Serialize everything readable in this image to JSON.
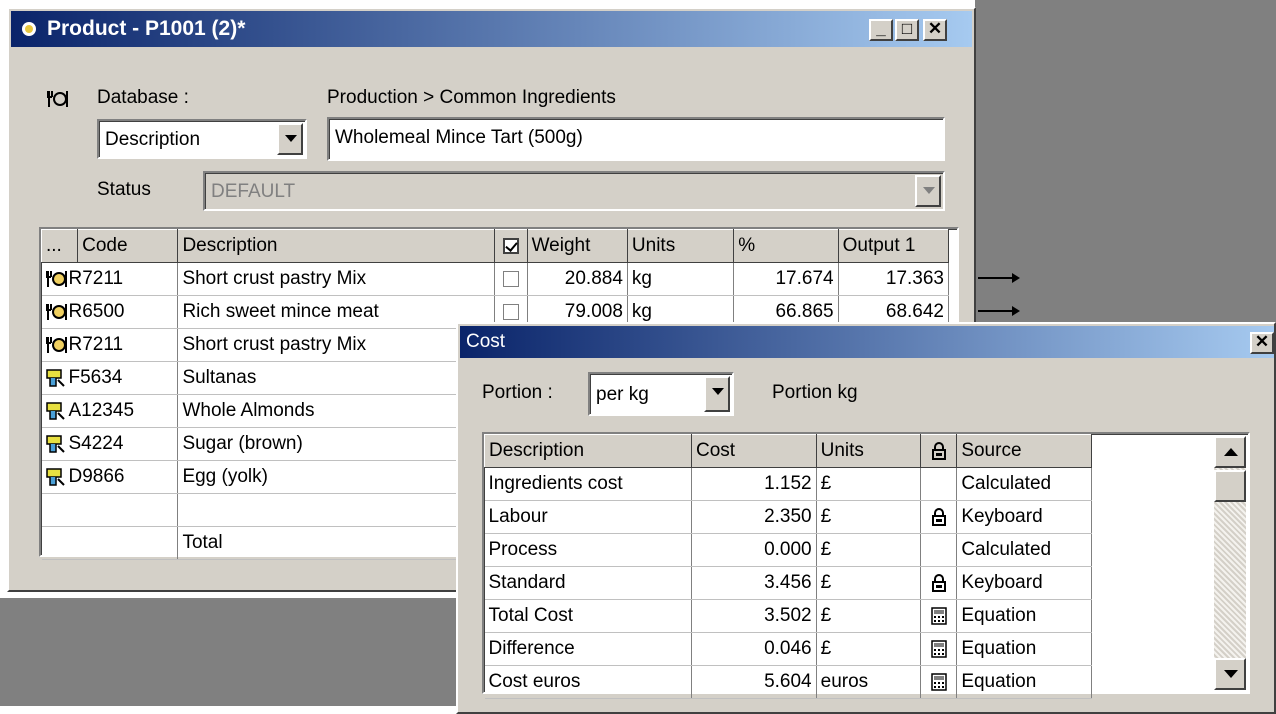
{
  "product_window": {
    "title": "Product - P1001 (2)*",
    "minimize": "_",
    "maximize": "□",
    "close": "✕",
    "database_label": "Database :",
    "breadcrumb": "Production > Common Ingredients",
    "field_select": "Description",
    "description_value": "Wholemeal Mince Tart (500g)",
    "status_label": "Status",
    "status_value": "DEFAULT"
  },
  "ingredients_grid": {
    "columns": [
      "...",
      "Code",
      "Description",
      "",
      "Weight",
      "Units",
      "%",
      "Output 1"
    ],
    "rows": [
      {
        "icon": "pot-icon",
        "code": "R7211",
        "description": "Short crust pastry Mix",
        "weight": "20.884",
        "units": "kg",
        "percent": "17.674",
        "output": "17.363"
      },
      {
        "icon": "pot-icon",
        "code": "R6500",
        "description": "Rich sweet mince meat",
        "weight": "79.008",
        "units": "kg",
        "percent": "66.865",
        "output": "68.642"
      },
      {
        "icon": "pot-icon",
        "code": "R7211",
        "description": "Short crust pastry Mix",
        "weight": "",
        "units": "",
        "percent": "",
        "output": ""
      },
      {
        "icon": "hand-icon",
        "code": "F5634",
        "description": "Sultanas",
        "weight": "",
        "units": "",
        "percent": "",
        "output": ""
      },
      {
        "icon": "hand-icon",
        "code": "A12345",
        "description": "Whole Almonds",
        "weight": "",
        "units": "",
        "percent": "",
        "output": ""
      },
      {
        "icon": "hand-icon",
        "code": "S4224",
        "description": "Sugar (brown)",
        "weight": "",
        "units": "",
        "percent": "",
        "output": ""
      },
      {
        "icon": "hand-icon",
        "code": "D9866",
        "description": "Egg (yolk)",
        "weight": "",
        "units": "",
        "percent": "",
        "output": ""
      },
      {
        "icon": "",
        "code": "",
        "description": "",
        "weight": "",
        "units": "",
        "percent": "",
        "output": ""
      },
      {
        "icon": "",
        "code": "",
        "description": "Total",
        "weight": "",
        "units": "",
        "percent": "",
        "output": ""
      }
    ]
  },
  "cost_window": {
    "title": "Cost",
    "close": "✕",
    "portion_label": "Portion :",
    "portion_value": "per kg",
    "portion_text": "Portion kg",
    "columns": [
      "Description",
      "Cost",
      "Units",
      "",
      "Source"
    ],
    "rows": [
      {
        "description": "Ingredients cost",
        "cost": "1.152",
        "units": "£",
        "icon": "",
        "source": "Calculated"
      },
      {
        "description": "Labour",
        "cost": "2.350",
        "units": "£",
        "icon": "lock-icon",
        "source": "Keyboard"
      },
      {
        "description": "Process",
        "cost": "0.000",
        "units": "£",
        "icon": "",
        "source": "Calculated"
      },
      {
        "description": "Standard",
        "cost": "3.456",
        "units": "£",
        "icon": "lock-icon",
        "source": "Keyboard"
      },
      {
        "description": "Total Cost",
        "cost": "3.502",
        "units": "£",
        "icon": "calculator-icon",
        "source": "Equation"
      },
      {
        "description": "Difference",
        "cost": "0.046",
        "units": "£",
        "icon": "calculator-icon",
        "source": "Equation"
      },
      {
        "description": "Cost euros",
        "cost": "5.604",
        "units": "euros",
        "icon": "calculator-icon",
        "source": "Equation"
      }
    ]
  }
}
